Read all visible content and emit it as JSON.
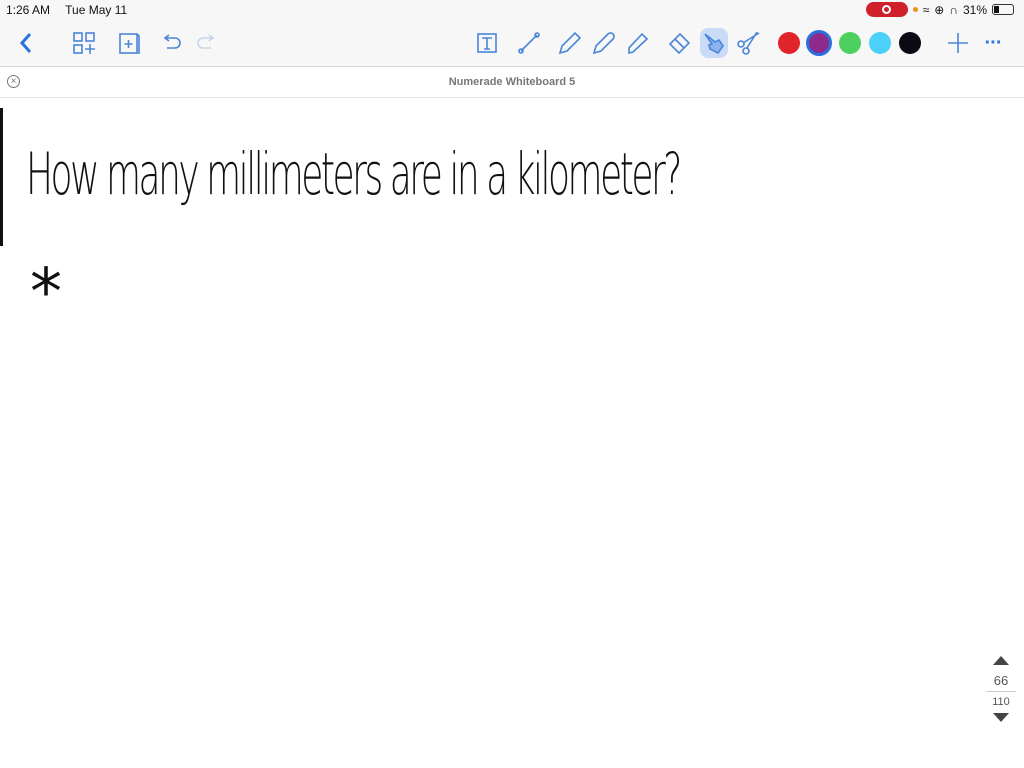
{
  "status": {
    "time": "1:26 AM",
    "date": "Tue May 11",
    "battery": "31%",
    "battery_level": 0.31
  },
  "toolbar": {
    "icons": [
      "back-icon",
      "pages-grid-icon",
      "add-page-icon",
      "undo-icon",
      "redo-icon",
      "text-tool-icon",
      "line-tool-icon",
      "pencil-icon",
      "pen-icon",
      "highlighter-icon",
      "eraser-icon",
      "pointer-hand-icon",
      "scissors-icon",
      "add-icon",
      "more-icon"
    ],
    "colors": [
      "#e0242a",
      "#8e2a8c",
      "#4cd060",
      "#4cd0f8",
      "#0a0a14"
    ],
    "selected_color": "#8e2a8c"
  },
  "document": {
    "title": "Numerade Whiteboard 5"
  },
  "canvas": {
    "question": "How many millimeters are in a kilometer?",
    "mark": "*"
  },
  "pager": {
    "current": "66",
    "total": "110"
  }
}
